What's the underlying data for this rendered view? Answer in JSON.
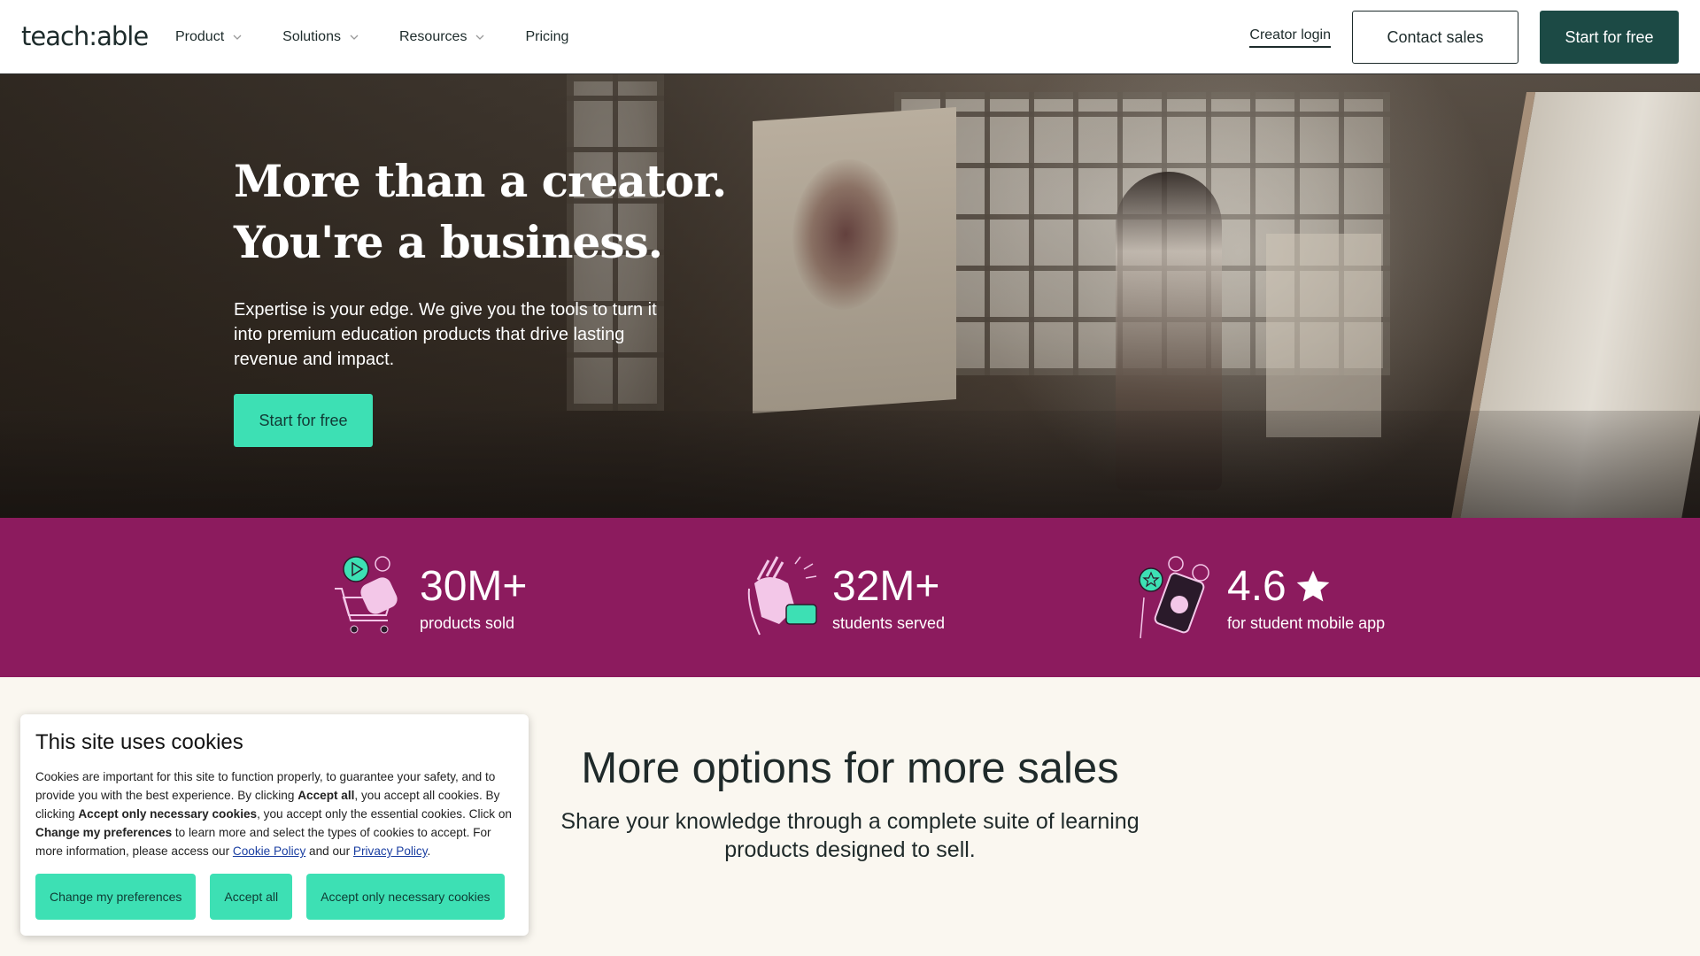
{
  "nav": {
    "logo": "teach:able",
    "menu": [
      {
        "label": "Product",
        "dropdown": true
      },
      {
        "label": "Solutions",
        "dropdown": true
      },
      {
        "label": "Resources",
        "dropdown": true
      },
      {
        "label": "Pricing",
        "dropdown": false
      }
    ],
    "creator_login": "Creator login",
    "contact_sales": "Contact sales",
    "start_free": "Start for free"
  },
  "hero": {
    "title_line1": "More than a creator.",
    "title_line2": "You're a business.",
    "subtitle": "Expertise is your edge. We give you the tools to turn it into premium education products that drive lasting revenue and impact.",
    "cta": "Start for free"
  },
  "stats": [
    {
      "value": "30M+",
      "label": "products sold",
      "icon": "shopping-cart-icon"
    },
    {
      "value": "32M+",
      "label": "students served",
      "icon": "clapping-hands-icon"
    },
    {
      "value": "4.6",
      "label": "for student mobile app",
      "icon": "mobile-rating-icon",
      "suffix_icon": "star-icon"
    }
  ],
  "section": {
    "title": "More options for more sales",
    "subtitle": "Share your knowledge through a complete suite of learning products designed to sell."
  },
  "cookie": {
    "title": "This site uses cookies",
    "text_1": "Cookies are important for this site to function properly, to guarantee your safety, and to provide you with the best experience. By clicking ",
    "accept_all_bold": "Accept all",
    "text_2": ", you accept all cookies. By clicking ",
    "accept_necessary_bold": "Accept only necessary cookies",
    "text_3": ", you accept only the essential cookies. Click on ",
    "change_pref_bold": "Change my preferences",
    "text_4": " to learn more and select the types of cookies to accept. For more information, please access our ",
    "cookie_policy": "Cookie Policy",
    "text_5": " and our ",
    "privacy_policy": "Privacy Policy",
    "text_6": ".",
    "btn_preferences": "Change my preferences",
    "btn_accept_all": "Accept all",
    "btn_necessary": "Accept only necessary cookies"
  },
  "colors": {
    "brand_dark": "#1c4a45",
    "accent_mint": "#3de0b4",
    "stats_bg": "#8c1b5e",
    "page_bg": "#faf7f0"
  }
}
